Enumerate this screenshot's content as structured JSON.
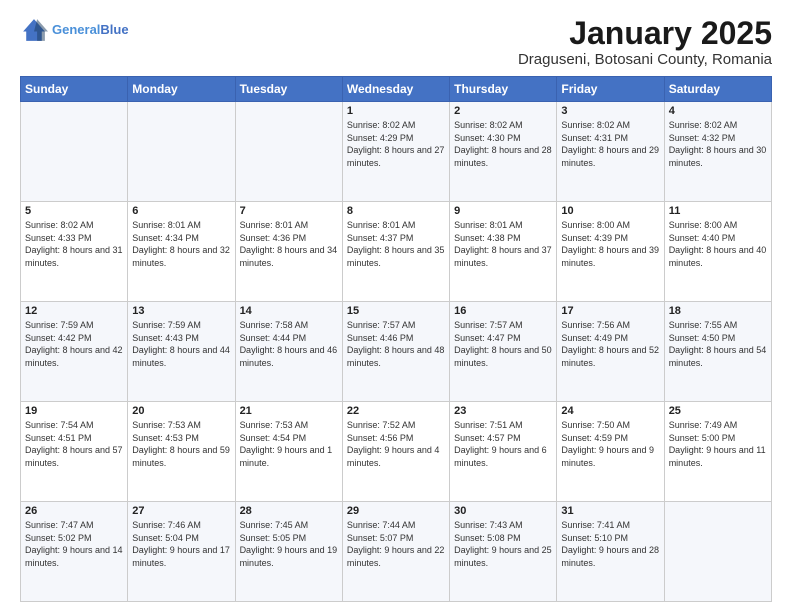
{
  "header": {
    "logo_line1": "General",
    "logo_line2": "Blue",
    "title": "January 2025",
    "subtitle": "Draguseni, Botosani County, Romania"
  },
  "weekdays": [
    "Sunday",
    "Monday",
    "Tuesday",
    "Wednesday",
    "Thursday",
    "Friday",
    "Saturday"
  ],
  "weeks": [
    [
      {
        "day": "",
        "info": ""
      },
      {
        "day": "",
        "info": ""
      },
      {
        "day": "",
        "info": ""
      },
      {
        "day": "1",
        "info": "Sunrise: 8:02 AM\nSunset: 4:29 PM\nDaylight: 8 hours and 27 minutes."
      },
      {
        "day": "2",
        "info": "Sunrise: 8:02 AM\nSunset: 4:30 PM\nDaylight: 8 hours and 28 minutes."
      },
      {
        "day": "3",
        "info": "Sunrise: 8:02 AM\nSunset: 4:31 PM\nDaylight: 8 hours and 29 minutes."
      },
      {
        "day": "4",
        "info": "Sunrise: 8:02 AM\nSunset: 4:32 PM\nDaylight: 8 hours and 30 minutes."
      }
    ],
    [
      {
        "day": "5",
        "info": "Sunrise: 8:02 AM\nSunset: 4:33 PM\nDaylight: 8 hours and 31 minutes."
      },
      {
        "day": "6",
        "info": "Sunrise: 8:01 AM\nSunset: 4:34 PM\nDaylight: 8 hours and 32 minutes."
      },
      {
        "day": "7",
        "info": "Sunrise: 8:01 AM\nSunset: 4:36 PM\nDaylight: 8 hours and 34 minutes."
      },
      {
        "day": "8",
        "info": "Sunrise: 8:01 AM\nSunset: 4:37 PM\nDaylight: 8 hours and 35 minutes."
      },
      {
        "day": "9",
        "info": "Sunrise: 8:01 AM\nSunset: 4:38 PM\nDaylight: 8 hours and 37 minutes."
      },
      {
        "day": "10",
        "info": "Sunrise: 8:00 AM\nSunset: 4:39 PM\nDaylight: 8 hours and 39 minutes."
      },
      {
        "day": "11",
        "info": "Sunrise: 8:00 AM\nSunset: 4:40 PM\nDaylight: 8 hours and 40 minutes."
      }
    ],
    [
      {
        "day": "12",
        "info": "Sunrise: 7:59 AM\nSunset: 4:42 PM\nDaylight: 8 hours and 42 minutes."
      },
      {
        "day": "13",
        "info": "Sunrise: 7:59 AM\nSunset: 4:43 PM\nDaylight: 8 hours and 44 minutes."
      },
      {
        "day": "14",
        "info": "Sunrise: 7:58 AM\nSunset: 4:44 PM\nDaylight: 8 hours and 46 minutes."
      },
      {
        "day": "15",
        "info": "Sunrise: 7:57 AM\nSunset: 4:46 PM\nDaylight: 8 hours and 48 minutes."
      },
      {
        "day": "16",
        "info": "Sunrise: 7:57 AM\nSunset: 4:47 PM\nDaylight: 8 hours and 50 minutes."
      },
      {
        "day": "17",
        "info": "Sunrise: 7:56 AM\nSunset: 4:49 PM\nDaylight: 8 hours and 52 minutes."
      },
      {
        "day": "18",
        "info": "Sunrise: 7:55 AM\nSunset: 4:50 PM\nDaylight: 8 hours and 54 minutes."
      }
    ],
    [
      {
        "day": "19",
        "info": "Sunrise: 7:54 AM\nSunset: 4:51 PM\nDaylight: 8 hours and 57 minutes."
      },
      {
        "day": "20",
        "info": "Sunrise: 7:53 AM\nSunset: 4:53 PM\nDaylight: 8 hours and 59 minutes."
      },
      {
        "day": "21",
        "info": "Sunrise: 7:53 AM\nSunset: 4:54 PM\nDaylight: 9 hours and 1 minute."
      },
      {
        "day": "22",
        "info": "Sunrise: 7:52 AM\nSunset: 4:56 PM\nDaylight: 9 hours and 4 minutes."
      },
      {
        "day": "23",
        "info": "Sunrise: 7:51 AM\nSunset: 4:57 PM\nDaylight: 9 hours and 6 minutes."
      },
      {
        "day": "24",
        "info": "Sunrise: 7:50 AM\nSunset: 4:59 PM\nDaylight: 9 hours and 9 minutes."
      },
      {
        "day": "25",
        "info": "Sunrise: 7:49 AM\nSunset: 5:00 PM\nDaylight: 9 hours and 11 minutes."
      }
    ],
    [
      {
        "day": "26",
        "info": "Sunrise: 7:47 AM\nSunset: 5:02 PM\nDaylight: 9 hours and 14 minutes."
      },
      {
        "day": "27",
        "info": "Sunrise: 7:46 AM\nSunset: 5:04 PM\nDaylight: 9 hours and 17 minutes."
      },
      {
        "day": "28",
        "info": "Sunrise: 7:45 AM\nSunset: 5:05 PM\nDaylight: 9 hours and 19 minutes."
      },
      {
        "day": "29",
        "info": "Sunrise: 7:44 AM\nSunset: 5:07 PM\nDaylight: 9 hours and 22 minutes."
      },
      {
        "day": "30",
        "info": "Sunrise: 7:43 AM\nSunset: 5:08 PM\nDaylight: 9 hours and 25 minutes."
      },
      {
        "day": "31",
        "info": "Sunrise: 7:41 AM\nSunset: 5:10 PM\nDaylight: 9 hours and 28 minutes."
      },
      {
        "day": "",
        "info": ""
      }
    ]
  ]
}
